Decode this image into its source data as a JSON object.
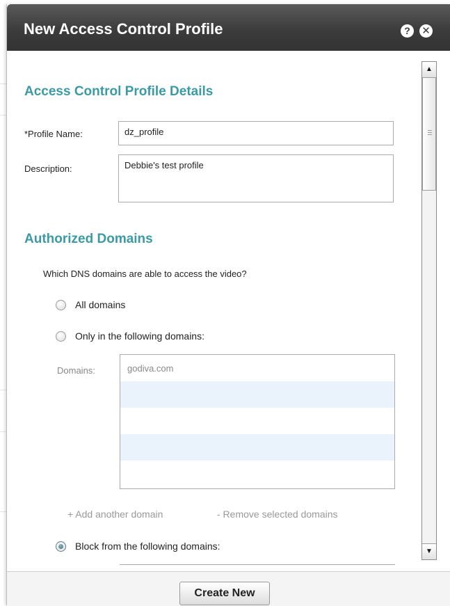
{
  "dialog": {
    "title": "New Access Control Profile",
    "help_icon": "?",
    "close_icon": "✕"
  },
  "details": {
    "heading": "Access Control Profile Details",
    "profile_name_label": "*Profile Name:",
    "profile_name_value": "dz_profile",
    "description_label": "Description:",
    "description_value": "Debbie's test profile"
  },
  "domains": {
    "heading": "Authorized Domains",
    "question": "Which DNS domains are able to access the video?",
    "options": [
      {
        "label": "All domains",
        "checked": false
      },
      {
        "label": "Only in the following domains:",
        "checked": false
      },
      {
        "label": "Block from the following domains:",
        "checked": true
      }
    ],
    "list_label": "Domains:",
    "list_rows": [
      "godiva.com",
      "",
      "",
      "",
      ""
    ],
    "add_link": "+ Add another domain",
    "remove_link": "- Remove selected domains"
  },
  "footer": {
    "create_button": "Create New"
  },
  "colors": {
    "section_heading": "#3b9aa3",
    "titlebar": "#3c3c3c",
    "alt_row": "#eaf2fb"
  }
}
